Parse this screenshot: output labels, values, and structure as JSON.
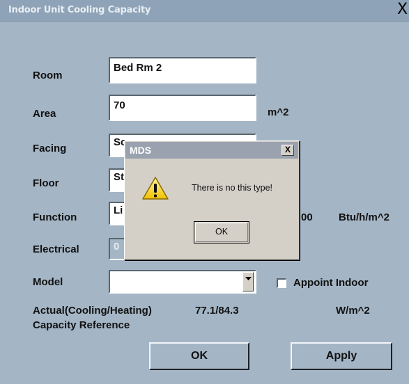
{
  "window": {
    "title": "Indoor Unit Cooling Capacity",
    "close_glyph": "X"
  },
  "form": {
    "room_label": "Room",
    "room_value": "Bed Rm 2",
    "area_label": "Area",
    "area_value": "70",
    "area_unit": "m^2",
    "facing_label": "Facing",
    "facing_value": "Sc",
    "floor_label": "Floor",
    "floor_value": "St",
    "function_label": "Function",
    "function_value": "Li",
    "function_value_right": "00",
    "function_unit": "Btu/h/m^2",
    "electrical_label": "Electrical",
    "electrical_value": "0",
    "model_label": "Model",
    "model_value": "",
    "appoint_label": "Appoint Indoor",
    "appoint_checked": false,
    "actual_label_line1": "Actual(Cooling/Heating)",
    "actual_label_line2": "Capacity Reference",
    "actual_value": "77.1/84.3",
    "actual_unit": "W/m^2"
  },
  "buttons": {
    "ok": "OK",
    "apply": "Apply"
  },
  "dialog": {
    "title": "MDS",
    "close_glyph": "X",
    "message": "There is no this type!",
    "ok": "OK",
    "icon": "warning-icon"
  },
  "colors": {
    "window_bg": "#a4b5c5",
    "titlebar": "#8ea3b7",
    "dialog_bg": "#d4d0c8",
    "dialog_title": "#9aa2af"
  }
}
